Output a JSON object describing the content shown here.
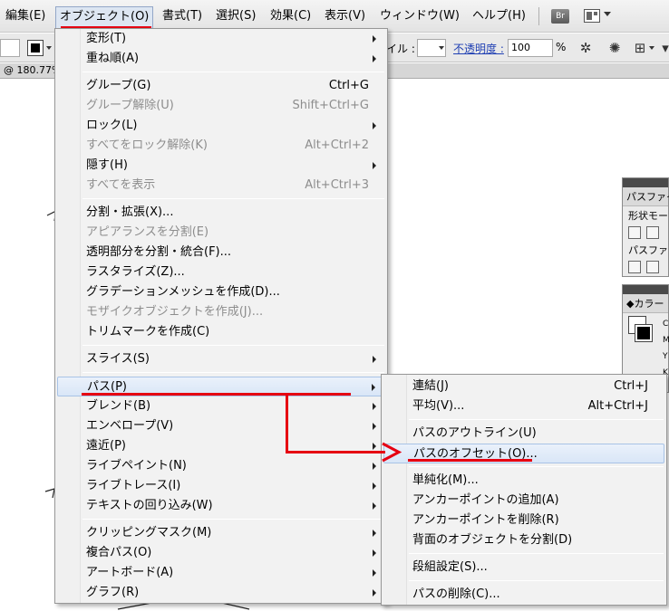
{
  "menubar": {
    "items": [
      "編集(E)",
      "オブジェクト(O)",
      "書式(T)",
      "選択(S)",
      "効果(C)",
      "表示(V)",
      "ウィンドウ(W)",
      "ヘルプ(H)"
    ],
    "bridge_label": "Br"
  },
  "controlbar": {
    "style_label": "イル :",
    "opacity_label": "不透明度 :",
    "opacity_value": "100",
    "percent": "%"
  },
  "doctab": {
    "zoom_text": "@ 180.77%"
  },
  "panels": {
    "pathfinder": {
      "title": "パスファイ",
      "row1": "形状モー",
      "row2": "パスファイ"
    },
    "color": {
      "title": "カラー",
      "letters": [
        "C",
        "M",
        "Y",
        "K"
      ]
    }
  },
  "object_menu": {
    "groups": [
      [
        {
          "label": "変形(T)",
          "shortcut": "",
          "submenu": true,
          "disabled": false
        },
        {
          "label": "重ね順(A)",
          "shortcut": "",
          "submenu": true,
          "disabled": false
        }
      ],
      [
        {
          "label": "グループ(G)",
          "shortcut": "Ctrl+G",
          "submenu": false,
          "disabled": false
        },
        {
          "label": "グループ解除(U)",
          "shortcut": "Shift+Ctrl+G",
          "submenu": false,
          "disabled": true
        },
        {
          "label": "ロック(L)",
          "shortcut": "",
          "submenu": true,
          "disabled": false
        },
        {
          "label": "すべてをロック解除(K)",
          "shortcut": "Alt+Ctrl+2",
          "submenu": false,
          "disabled": true
        },
        {
          "label": "隠す(H)",
          "shortcut": "",
          "submenu": true,
          "disabled": false
        },
        {
          "label": "すべてを表示",
          "shortcut": "Alt+Ctrl+3",
          "submenu": false,
          "disabled": true
        }
      ],
      [
        {
          "label": "分割・拡張(X)...",
          "shortcut": "",
          "submenu": false,
          "disabled": false
        },
        {
          "label": "アピアランスを分割(E)",
          "shortcut": "",
          "submenu": false,
          "disabled": true
        },
        {
          "label": "透明部分を分割・統合(F)...",
          "shortcut": "",
          "submenu": false,
          "disabled": false
        },
        {
          "label": "ラスタライズ(Z)...",
          "shortcut": "",
          "submenu": false,
          "disabled": false
        },
        {
          "label": "グラデーションメッシュを作成(D)...",
          "shortcut": "",
          "submenu": false,
          "disabled": false
        },
        {
          "label": "モザイクオブジェクトを作成(J)...",
          "shortcut": "",
          "submenu": false,
          "disabled": true
        },
        {
          "label": "トリムマークを作成(C)",
          "shortcut": "",
          "submenu": false,
          "disabled": false
        }
      ],
      [
        {
          "label": "スライス(S)",
          "shortcut": "",
          "submenu": true,
          "disabled": false
        }
      ],
      [
        {
          "label": "パス(P)",
          "shortcut": "",
          "submenu": true,
          "disabled": false,
          "highlighted": true
        },
        {
          "label": "ブレンド(B)",
          "shortcut": "",
          "submenu": true,
          "disabled": false
        },
        {
          "label": "エンベロープ(V)",
          "shortcut": "",
          "submenu": true,
          "disabled": false
        },
        {
          "label": "遠近(P)",
          "shortcut": "",
          "submenu": true,
          "disabled": false
        },
        {
          "label": "ライブペイント(N)",
          "shortcut": "",
          "submenu": true,
          "disabled": false
        },
        {
          "label": "ライブトレース(I)",
          "shortcut": "",
          "submenu": true,
          "disabled": false
        },
        {
          "label": "テキストの回り込み(W)",
          "shortcut": "",
          "submenu": true,
          "disabled": false
        }
      ],
      [
        {
          "label": "クリッピングマスク(M)",
          "shortcut": "",
          "submenu": true,
          "disabled": false
        },
        {
          "label": "複合パス(O)",
          "shortcut": "",
          "submenu": true,
          "disabled": false
        },
        {
          "label": "アートボード(A)",
          "shortcut": "",
          "submenu": true,
          "disabled": false
        },
        {
          "label": "グラフ(R)",
          "shortcut": "",
          "submenu": true,
          "disabled": false
        }
      ]
    ]
  },
  "path_submenu": {
    "groups": [
      [
        {
          "label": "連結(J)",
          "shortcut": "Ctrl+J"
        },
        {
          "label": "平均(V)...",
          "shortcut": "Alt+Ctrl+J"
        }
      ],
      [
        {
          "label": "パスのアウトライン(U)",
          "shortcut": ""
        },
        {
          "label": "パスのオフセット(O)...",
          "shortcut": "",
          "highlighted": true
        }
      ],
      [
        {
          "label": "単純化(M)...",
          "shortcut": ""
        },
        {
          "label": "アンカーポイントの追加(A)",
          "shortcut": ""
        },
        {
          "label": "アンカーポイントを削除(R)",
          "shortcut": ""
        },
        {
          "label": "背面のオブジェクトを分割(D)",
          "shortcut": ""
        }
      ],
      [
        {
          "label": "段組設定(S)...",
          "shortcut": ""
        }
      ],
      [
        {
          "label": "パスの削除(C)...",
          "shortcut": ""
        }
      ]
    ]
  },
  "colors": {
    "annotation_red": "#e60012",
    "highlight": "#d9e6f7"
  }
}
